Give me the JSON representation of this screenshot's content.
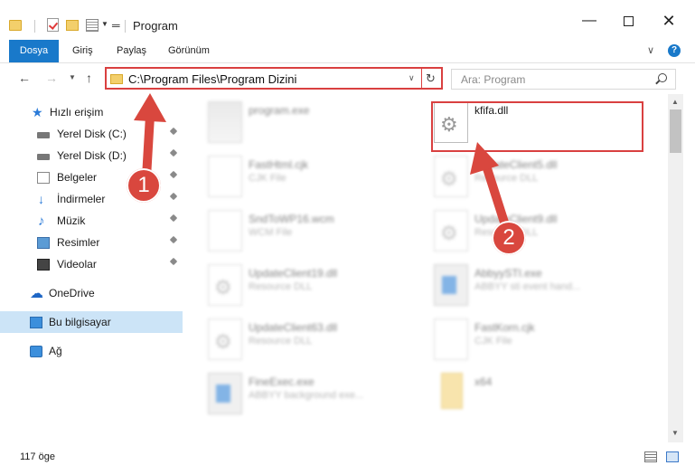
{
  "window": {
    "title": "Program",
    "controls": {
      "minimize": "—",
      "close": "✕"
    }
  },
  "ribbon": {
    "tabs": [
      "Dosya",
      "Giriş",
      "Paylaş",
      "Görünüm"
    ],
    "help": "?"
  },
  "nav": {
    "address": "C:\\Program Files\\Program Dizini",
    "search_placeholder": "Ara: Program"
  },
  "sidebar": {
    "items": [
      {
        "label": "Hızlı erişim",
        "icon": "star-icon",
        "pinned": false
      },
      {
        "label": "Yerel Disk (C:)",
        "icon": "disk-icon",
        "pinned": true
      },
      {
        "label": "Yerel Disk (D:)",
        "icon": "disk-icon",
        "pinned": true
      },
      {
        "label": "Belgeler",
        "icon": "documents-icon",
        "pinned": true
      },
      {
        "label": "İndirmeler",
        "icon": "downloads-icon",
        "pinned": true
      },
      {
        "label": "Müzik",
        "icon": "music-icon",
        "pinned": true
      },
      {
        "label": "Resimler",
        "icon": "pictures-icon",
        "pinned": true
      },
      {
        "label": "Videolar",
        "icon": "videos-icon",
        "pinned": true
      },
      {
        "label": "OneDrive",
        "icon": "onedrive-icon",
        "pinned": false
      },
      {
        "label": "Bu bilgisayar",
        "icon": "computer-icon",
        "pinned": false,
        "selected": true
      },
      {
        "label": "Ağ",
        "icon": "network-icon",
        "pinned": false
      }
    ]
  },
  "files": [
    {
      "name": "program.exe",
      "type": "",
      "icon": "installer-icon",
      "blurred": true
    },
    {
      "name": "kfifa.dll",
      "type": "",
      "icon": "dll-gear-icon",
      "blurred": false,
      "highlighted": true
    },
    {
      "name": "FastHtml.cjk",
      "type": "CJK File",
      "icon": "file-icon",
      "blurred": true
    },
    {
      "name": "UpdateClient5.dll",
      "type": "Resource DLL",
      "icon": "dll-gear-icon",
      "blurred": true
    },
    {
      "name": "SndToWP16.wcm",
      "type": "WCM File",
      "icon": "file-icon",
      "blurred": true
    },
    {
      "name": "UpdateClient9.dll",
      "type": "Resource DLL",
      "icon": "dll-gear-icon",
      "blurred": true
    },
    {
      "name": "UpdateClient19.dll",
      "type": "Resource DLL",
      "icon": "dll-gear-icon",
      "blurred": true
    },
    {
      "name": "AbbyySTI.exe",
      "type": "ABBYY sti event hand...",
      "icon": "exe-icon",
      "blurred": true
    },
    {
      "name": "UpdateClient63.dll",
      "type": "Resource DLL",
      "icon": "dll-gear-icon",
      "blurred": true
    },
    {
      "name": "FastKorn.cjk",
      "type": "CJK File",
      "icon": "file-icon",
      "blurred": true
    },
    {
      "name": "FineExec.exe",
      "type": "ABBYY background exe...",
      "icon": "exe-icon",
      "blurred": true
    },
    {
      "name": "x64",
      "type": "",
      "icon": "folder-icon",
      "blurred": true
    }
  ],
  "status": {
    "item_count": "117 öge"
  },
  "markers": [
    "1",
    "2"
  ],
  "colors": {
    "accent": "#1979ca",
    "highlight": "#d94040",
    "selected_bg": "#cce4f7"
  }
}
